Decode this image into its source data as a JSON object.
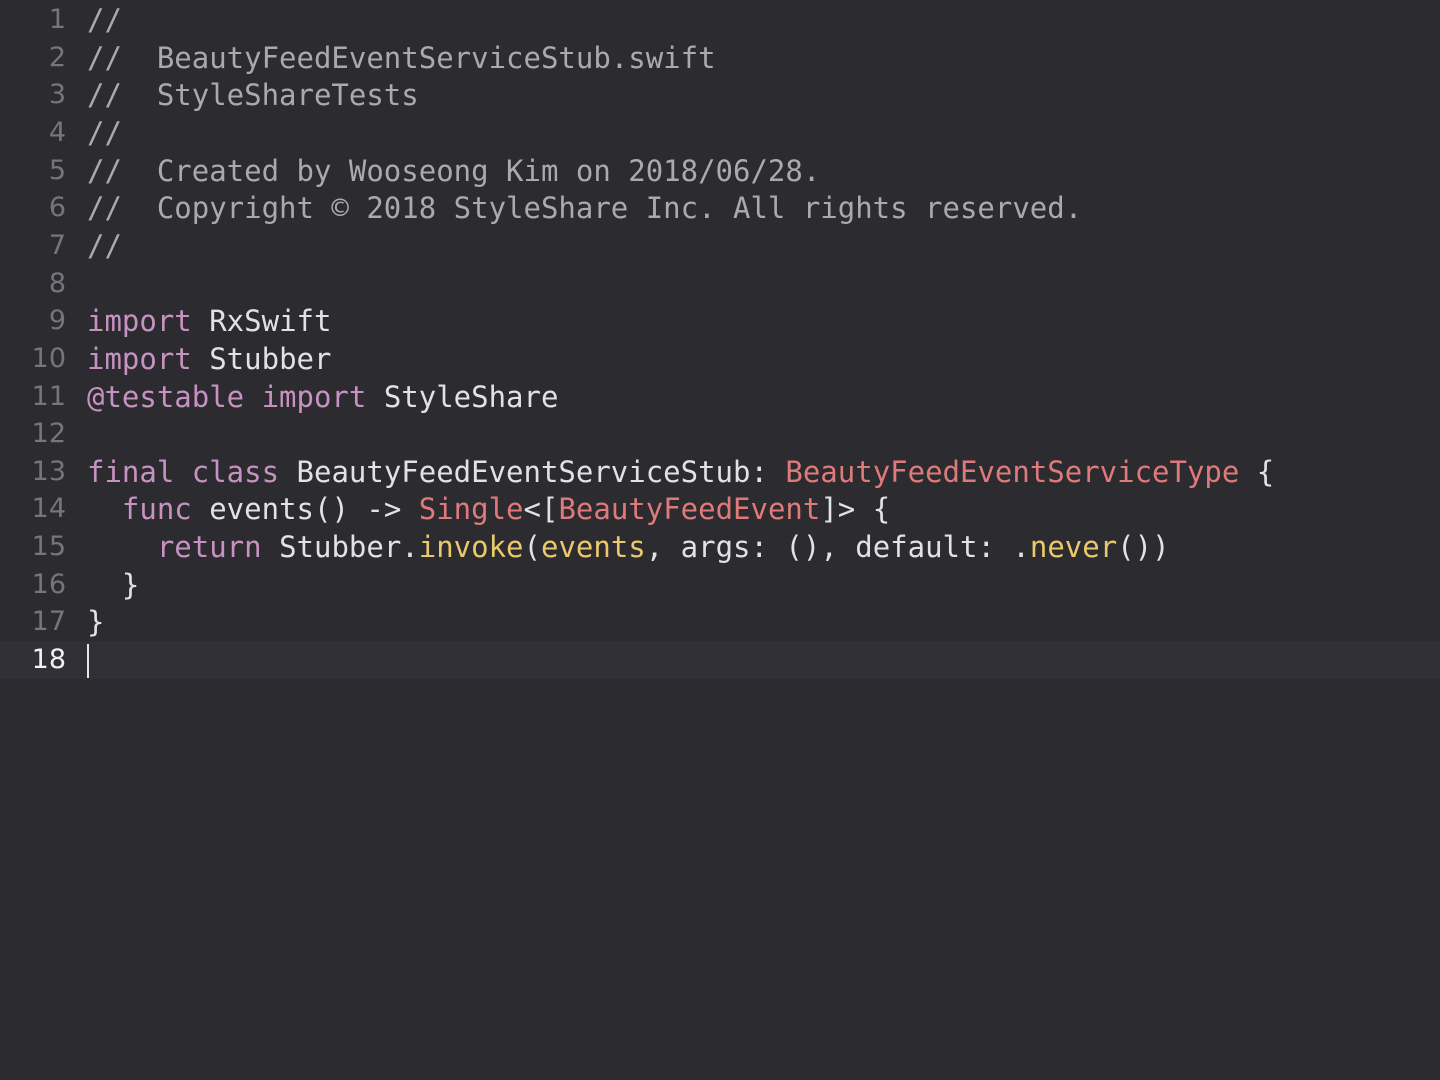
{
  "editor": {
    "file_name": "BeautyFeedEventServiceStub.swift",
    "current_line": 18,
    "lines": [
      {
        "number": "1",
        "tokens": [
          {
            "t": "//",
            "c": "cm"
          }
        ]
      },
      {
        "number": "2",
        "tokens": [
          {
            "t": "//  BeautyFeedEventServiceStub.swift",
            "c": "cm"
          }
        ]
      },
      {
        "number": "3",
        "tokens": [
          {
            "t": "//  StyleShareTests",
            "c": "cm"
          }
        ]
      },
      {
        "number": "4",
        "tokens": [
          {
            "t": "//",
            "c": "cm"
          }
        ]
      },
      {
        "number": "5",
        "tokens": [
          {
            "t": "//  Created by Wooseong Kim on 2018/06/28.",
            "c": "cm"
          }
        ]
      },
      {
        "number": "6",
        "tokens": [
          {
            "t": "//  Copyright © 2018 StyleShare Inc. All rights reserved.",
            "c": "cm"
          }
        ]
      },
      {
        "number": "7",
        "tokens": [
          {
            "t": "//",
            "c": "cm"
          }
        ]
      },
      {
        "number": "8",
        "tokens": []
      },
      {
        "number": "9",
        "tokens": [
          {
            "t": "import",
            "c": "kw"
          },
          {
            "t": " RxSwift",
            "c": "pl"
          }
        ]
      },
      {
        "number": "10",
        "tokens": [
          {
            "t": "import",
            "c": "kw"
          },
          {
            "t": " Stubber",
            "c": "pl"
          }
        ]
      },
      {
        "number": "11",
        "tokens": [
          {
            "t": "@testable import",
            "c": "kw"
          },
          {
            "t": " StyleShare",
            "c": "pl"
          }
        ]
      },
      {
        "number": "12",
        "tokens": []
      },
      {
        "number": "13",
        "tokens": [
          {
            "t": "final class",
            "c": "kw"
          },
          {
            "t": " BeautyFeedEventServiceStub: ",
            "c": "pl"
          },
          {
            "t": "BeautyFeedEventServiceType",
            "c": "ty"
          },
          {
            "t": " {",
            "c": "pl"
          }
        ]
      },
      {
        "number": "14",
        "tokens": [
          {
            "t": "  ",
            "c": "pl"
          },
          {
            "t": "func",
            "c": "kw"
          },
          {
            "t": " events() -> ",
            "c": "pl"
          },
          {
            "t": "Single",
            "c": "ty"
          },
          {
            "t": "<[",
            "c": "pl"
          },
          {
            "t": "BeautyFeedEvent",
            "c": "ty"
          },
          {
            "t": "]> {",
            "c": "pl"
          }
        ]
      },
      {
        "number": "15",
        "tokens": [
          {
            "t": "    ",
            "c": "pl"
          },
          {
            "t": "return",
            "c": "kw"
          },
          {
            "t": " Stubber.",
            "c": "pl"
          },
          {
            "t": "invoke",
            "c": "fn"
          },
          {
            "t": "(",
            "c": "pl"
          },
          {
            "t": "events",
            "c": "fn"
          },
          {
            "t": ", args: (), default: .",
            "c": "pl"
          },
          {
            "t": "never",
            "c": "fn"
          },
          {
            "t": "())",
            "c": "pl"
          }
        ]
      },
      {
        "number": "16",
        "tokens": [
          {
            "t": "  }",
            "c": "pl"
          }
        ]
      },
      {
        "number": "17",
        "tokens": [
          {
            "t": "}",
            "c": "pl"
          }
        ]
      },
      {
        "number": "18",
        "tokens": []
      }
    ]
  }
}
